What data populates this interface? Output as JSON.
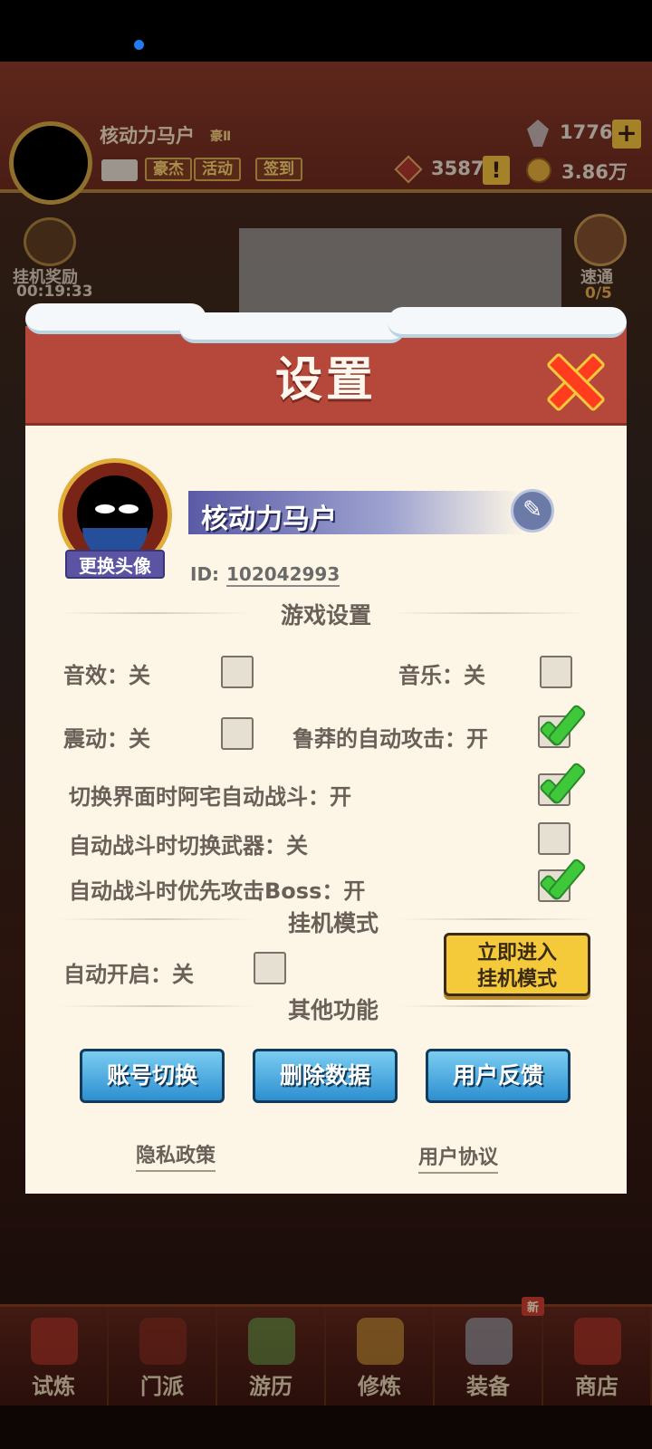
{
  "hud": {
    "player_name": "核动力马户",
    "rank_tag": "豪Ⅱ",
    "chips": [
      "豪杰",
      "活动",
      "签到"
    ],
    "gems": "1776",
    "plus_icon": "+",
    "tokens": "3587",
    "alert_icon": "!",
    "coins": "3.86万",
    "idle_reward_label": "挂机奖励",
    "idle_timer": "00:19:33",
    "sweep_label": "速通",
    "sweep_count": "0/5"
  },
  "dialog": {
    "title": "设置",
    "profile": {
      "name": "核动力马户",
      "change_avatar": "更换头像",
      "id_label": "ID:",
      "id_value": "102042993"
    },
    "game_settings": {
      "section_title": "游戏设置",
      "sound_effects": "音效：关",
      "music": "音乐：关",
      "vibration": "震动：关",
      "reckless_auto_attack": "鲁莽的自动攻击：开",
      "auto_battle_on_switch": "切换界面时阿宅自动战斗：开",
      "switch_weapon_auto": "自动战斗时切换武器：关",
      "prioritize_boss": "自动战斗时优先攻击Boss：开"
    },
    "idle_mode": {
      "section_title": "挂机模式",
      "auto_start": "自动开启：关",
      "enter_now_line1": "立即进入",
      "enter_now_line2": "挂机模式"
    },
    "other": {
      "section_title": "其他功能",
      "switch_account": "账号切换",
      "delete_data": "删除数据",
      "feedback": "用户反馈"
    },
    "links": {
      "privacy": "隐私政策",
      "user_agreement": "用户协议"
    }
  },
  "nav": {
    "items": [
      "试炼",
      "门派",
      "游历",
      "修炼",
      "装备",
      "商店"
    ],
    "new_badge": "新"
  },
  "colors": {
    "dialog_header": "#b6483b",
    "dialog_body": "#fdf6e6",
    "check_green": "#3ec83a",
    "button_blue": "#2e8fd0",
    "button_yellow": "#f4c93a",
    "close_red": "#ff3c1e"
  },
  "icons": {
    "close": "close-icon",
    "edit": "edit-icon",
    "check": "check-icon",
    "gem": "gem-icon",
    "coin": "coin-icon",
    "mail": "mail-icon"
  },
  "toggles": {
    "sound_effects": false,
    "music": false,
    "vibration": false,
    "reckless_auto_attack": true,
    "auto_battle_on_switch": true,
    "switch_weapon_auto": false,
    "prioritize_boss": true,
    "idle_auto_start": false
  }
}
